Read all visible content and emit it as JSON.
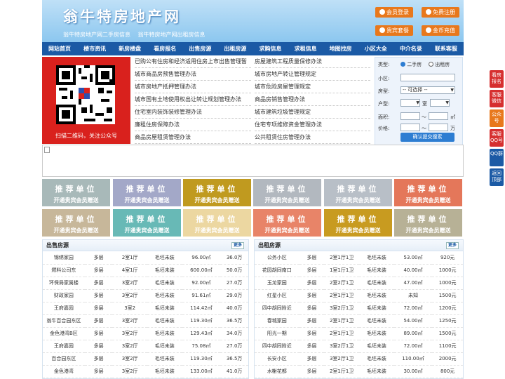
{
  "header": {
    "logo": "翁牛特房地产网",
    "sublinks": [
      "翁牛特房地产网二手房信息",
      "翁牛特房地产网出租房信息"
    ],
    "buttons": [
      "会员登录",
      "免费注册",
      "贵宾套餐",
      "金币充值"
    ]
  },
  "nav": [
    "网站首页",
    "楼市资讯",
    "新房楼盘",
    "看房报名",
    "出售房源",
    "出租房源",
    "求购信息",
    "求租信息",
    "地图找房",
    "小区大全",
    "中介名录",
    "联系客服"
  ],
  "qr_caption": "扫描二维码，关注公众号",
  "news_left": [
    "已购公有住房和经济适用住房上市出售管理暂",
    "城市商品房预售管理办法",
    "城市房地产抵押管理办法",
    "城市国有土地使用权出让转让规划管理办法",
    "住宅室内装饰装修管理办法",
    "廉租住房保障办法",
    "商品房屋租赁管理办法"
  ],
  "news_right": [
    "房屋建筑工程质量保修办法",
    "城市房地产转让管理规定",
    "城市危险房屋管理规定",
    "商品房销售管理办法",
    "城市建筑垃圾管理规定",
    "住宅专项维修资金管理办法",
    "公共租赁住房管理办法"
  ],
  "search": {
    "type_label": "类型:",
    "opt1": "二手房",
    "opt2": "出租房",
    "community_label": "小区:",
    "room_label": "房型:",
    "room_value": "-- 可选择 --",
    "layout_label": "户型:",
    "unit_room": "室",
    "area_label": "面积:",
    "unit_area": "㎡",
    "price_label": "价格:",
    "unit_price": "万",
    "tilde": "～",
    "submit": "确认提交搜索"
  },
  "tiles": {
    "line1": "推荐单位",
    "line2": "开通贵宾会员赠送",
    "colors": [
      "#a8b9b9",
      "#a3a8c8",
      "#c09a1f",
      "#b2b8bf",
      "#b8bfc7",
      "#e4775a",
      "#c7b79a",
      "#68b9b6",
      "#ecd7a1",
      "#e88468",
      "#c89b20",
      "#b7b196"
    ]
  },
  "sale": {
    "title": "出售房源",
    "more": "更多",
    "rows": [
      [
        "锦绣家园",
        "多层",
        "2室1厅",
        "毛坯未装",
        "96.00㎡",
        "36.0万"
      ],
      [
        "燃料公司东",
        "多层",
        "4室1厅",
        "毛坯未装",
        "600.00㎡",
        "50.0万"
      ],
      [
        "环保局家属楼",
        "多层",
        "3室2厅",
        "毛坯未装",
        "92.00㎡",
        "27.0万"
      ],
      [
        "财政家园",
        "多层",
        "3室2厅",
        "毛坯未装",
        "91.61㎡",
        "29.0万"
      ],
      [
        "王府嘉园",
        "多层",
        "3室2",
        "毛坯未装",
        "114.42㎡",
        "40.0万"
      ],
      [
        "翁牛百合园东区",
        "多层",
        "3室2厅",
        "毛坯未装",
        "119.30㎡",
        "36.5万"
      ],
      [
        "金色港湾B区",
        "多层",
        "3室2厅",
        "毛坯未装",
        "129.43㎡",
        "34.0万"
      ],
      [
        "王府嘉园",
        "多层",
        "3室2厅",
        "毛坯未装",
        "75.08㎡",
        "27.0万"
      ],
      [
        "百合园东区",
        "多层",
        "3室2厅",
        "毛坯未装",
        "119.30㎡",
        "36.5万"
      ],
      [
        "金色港湾",
        "多层",
        "3室2厅",
        "毛坯未装",
        "133.00㎡",
        "41.0万"
      ]
    ]
  },
  "rent": {
    "title": "出租房源",
    "more": "更多",
    "rows": [
      [
        "公务小区",
        "多层",
        "2室1厅1卫",
        "毛坯未装",
        "53.00㎡",
        "920元"
      ],
      [
        "花园胡同南口",
        "多层",
        "1室1厅1卫",
        "毛坯未装",
        "40.00㎡",
        "1000元"
      ],
      [
        "玉龙家园",
        "多层",
        "2室2厅1卫",
        "毛坯未装",
        "47.00㎡",
        "1000元"
      ],
      [
        "红星小区",
        "多层",
        "2室1厅1卫",
        "毛坯未装",
        "未知",
        "1500元"
      ],
      [
        "四中胡同附近",
        "多层",
        "3室2厅1卫",
        "毛坯未装",
        "72.00㎡",
        "1200元"
      ],
      [
        "春城家园",
        "多层",
        "2室1厅1卫",
        "毛坯未装",
        "54.00㎡",
        "1250元"
      ],
      [
        "阳光一期",
        "多层",
        "2室1厅1卫",
        "毛坯未装",
        "89.00㎡",
        "1500元"
      ],
      [
        "四中胡同附近",
        "多层",
        "3室2厅1卫",
        "毛坯未装",
        "72.00㎡",
        "1100元"
      ],
      [
        "长安小区",
        "多层",
        "3室2厅1卫",
        "毛坯未装",
        "110.00㎡",
        "2000元"
      ],
      [
        "水榭花都",
        "多层",
        "2室1厅1卫",
        "毛坯未装",
        "30.00㎡",
        "800元"
      ]
    ]
  },
  "floats": [
    {
      "label": "看房报名",
      "color": "#d62f2f"
    },
    {
      "label": "客服微信",
      "color": "#d62f2f"
    },
    {
      "label": "公众号",
      "color": "#e8781c"
    },
    {
      "label": "客服QQ号",
      "color": "#d62f2f"
    },
    {
      "label": "QQ群",
      "color": "#1b5aa5"
    },
    {
      "label": "返回顶部",
      "color": "#1b5aa5"
    }
  ]
}
